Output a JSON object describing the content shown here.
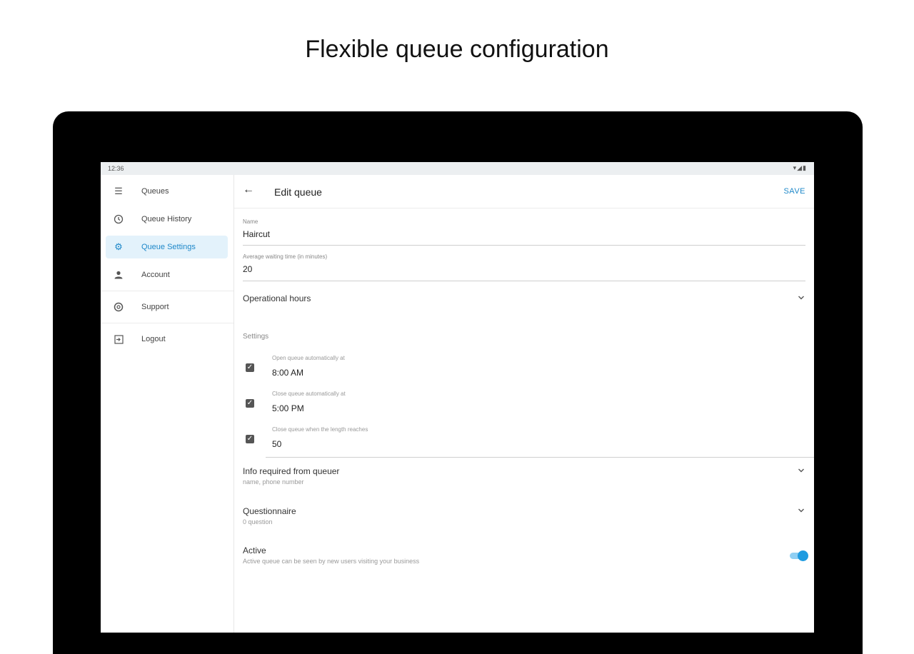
{
  "headline": "Flexible queue configuration",
  "statusbar": {
    "time": "12:36",
    "icons": "▾◢▮"
  },
  "drawer": {
    "items": [
      {
        "label": "Queues",
        "icon": "menu-icon"
      },
      {
        "label": "Queue History",
        "icon": "history-icon"
      },
      {
        "label": "Queue Settings",
        "icon": "gear-icon",
        "active": true
      },
      {
        "label": "Account",
        "icon": "person-icon"
      },
      {
        "label": "Support",
        "icon": "support-icon"
      },
      {
        "label": "Logout",
        "icon": "logout-icon"
      }
    ]
  },
  "appbar": {
    "back": "←",
    "title": "Edit queue",
    "save": "SAVE"
  },
  "form": {
    "name": {
      "label": "Name",
      "value": "Haircut"
    },
    "avg_wait": {
      "label": "Average waiting time (in minutes)",
      "value": "20"
    },
    "operational_hours": {
      "title": "Operational hours"
    },
    "settings_label": "Settings",
    "settings": [
      {
        "label": "Open queue automatically at",
        "value": "8:00 AM",
        "checked": true
      },
      {
        "label": "Close queue automatically at",
        "value": "5:00 PM",
        "checked": true
      },
      {
        "label": "Close queue when the length reaches",
        "value": "50",
        "checked": true
      }
    ],
    "info_required": {
      "title": "Info required from queuer",
      "subtitle": "name, phone number"
    },
    "questionnaire": {
      "title": "Questionnaire",
      "subtitle": "0 question"
    },
    "active": {
      "title": "Active",
      "subtitle": "Active queue can be seen by new users visiting your business",
      "on": true
    }
  },
  "colors": {
    "accent": "#1e88c9",
    "active_bg": "#e3f2fb",
    "bezel": "#000000"
  }
}
